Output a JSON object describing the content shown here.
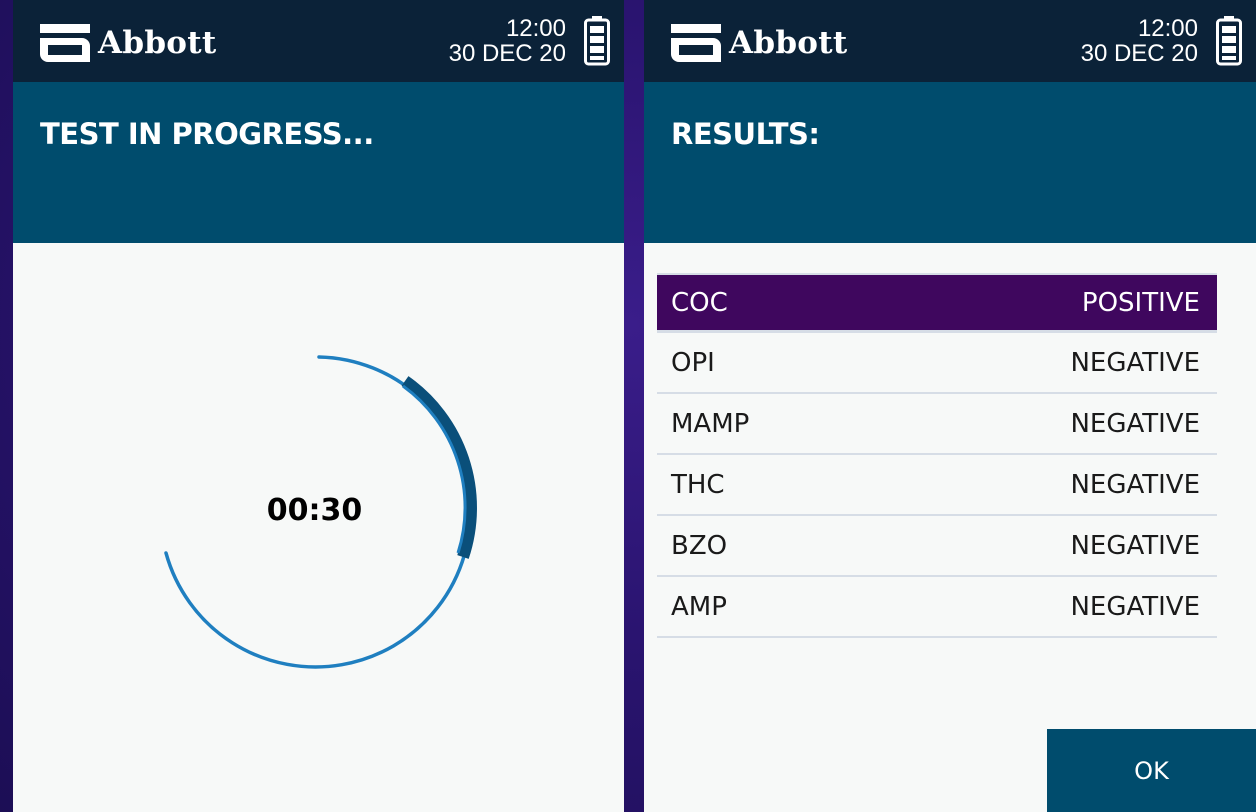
{
  "brand": {
    "name": "Abbott"
  },
  "left_screen": {
    "status": {
      "time": "12:00",
      "date": "30 DEC 20"
    },
    "title": "TEST IN PROGRESS...",
    "timer": {
      "text": "00:30"
    }
  },
  "right_screen": {
    "status": {
      "time": "12:00",
      "date": "30 DEC 20"
    },
    "title": "RESULTS:",
    "results": [
      {
        "drug": "COC",
        "result": "POSITIVE"
      },
      {
        "drug": "OPI",
        "result": "NEGATIVE"
      },
      {
        "drug": "MAMP",
        "result": "NEGATIVE"
      },
      {
        "drug": "THC",
        "result": "NEGATIVE"
      },
      {
        "drug": "BZO",
        "result": "NEGATIVE"
      },
      {
        "drug": "AMP",
        "result": "NEGATIVE"
      }
    ],
    "ok_label": "OK"
  },
  "colors": {
    "top_bar": "#0b2238",
    "header_band": "#004c6d",
    "positive_row": "#3f075e",
    "ring": "#1f7fc0",
    "ring_highlight": "#0a4f7a"
  }
}
